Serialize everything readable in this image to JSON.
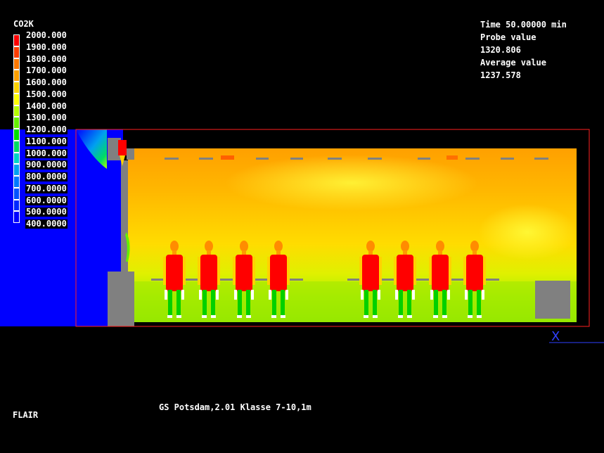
{
  "legend": {
    "title": "CO2K",
    "levels": [
      {
        "value": "2000.000",
        "color": "#ff0000"
      },
      {
        "value": "1900.000",
        "color": "#ff3c00"
      },
      {
        "value": "1800.000",
        "color": "#ff7800"
      },
      {
        "value": "1700.000",
        "color": "#ffa000"
      },
      {
        "value": "1600.000",
        "color": "#ffd200"
      },
      {
        "value": "1500.000",
        "color": "#ffff00"
      },
      {
        "value": "1400.000",
        "color": "#b4ff00"
      },
      {
        "value": "1300.000",
        "color": "#64f000"
      },
      {
        "value": "1200.000",
        "color": "#00e000"
      },
      {
        "value": "1100.000",
        "color": "#00dc64"
      },
      {
        "value": "1000.000",
        "color": "#00d2c8"
      },
      {
        "value": "900.0000",
        "color": "#00a0f0"
      },
      {
        "value": "800.0000",
        "color": "#0078ff"
      },
      {
        "value": "700.0000",
        "color": "#0050ff"
      },
      {
        "value": "600.0000",
        "color": "#0028ff"
      },
      {
        "value": "500.0000",
        "color": "#0000ff"
      },
      {
        "value": "400.0000",
        "color": "#000000"
      }
    ]
  },
  "info": {
    "time": "Time 50.00000 min",
    "probe_label": "Probe value",
    "probe_value": "1320.806",
    "average_label": "Average value",
    "average_value": "1237.578"
  },
  "caption": "GS Potsdam,2.01 Klasse 7-10,1m",
  "brand": "FLAIR",
  "axis_label": "X",
  "colors": {
    "frame": "#ff2020",
    "background": "#000000"
  }
}
